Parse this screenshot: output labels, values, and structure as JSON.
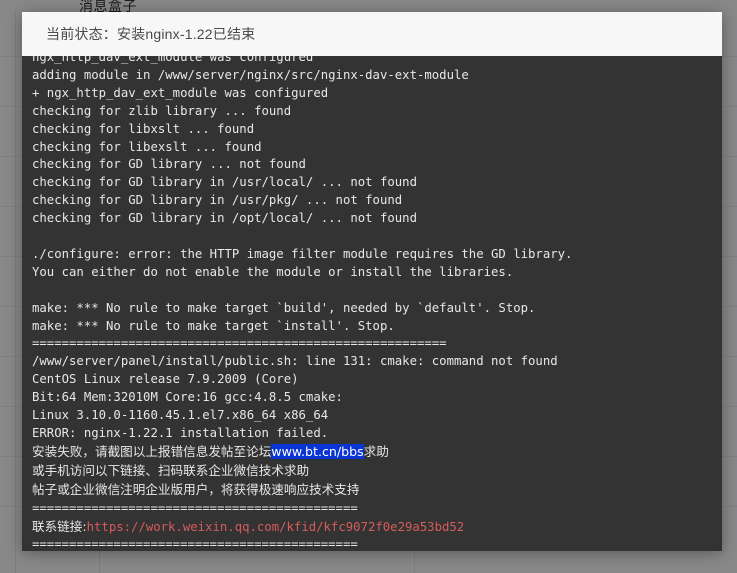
{
  "background": {
    "page_title": "消息盒子"
  },
  "modal": {
    "status_label": "当前状态：安装nginx-1.22已结束"
  },
  "terminal": {
    "colors": {
      "background": "#333333",
      "text": "#e7e7e7",
      "link_red": "#d65b5b",
      "selection_background": "#0a35d5",
      "selection_text": "#ffffff"
    },
    "lines": [
      {
        "id": "line-clipped",
        "text": "ngx_http_dav_ext_module was configured",
        "clipped": true
      },
      {
        "id": "line-adding-module",
        "text": "adding module in /www/server/nginx/src/nginx-dav-ext-module"
      },
      {
        "id": "line-dav-configured",
        "text": "+ ngx_http_dav_ext_module was configured"
      },
      {
        "id": "line-zlib",
        "text": "checking for zlib library ... found"
      },
      {
        "id": "line-libxslt",
        "text": "checking for libxslt ... found"
      },
      {
        "id": "line-libexslt",
        "text": "checking for libexslt ... found"
      },
      {
        "id": "line-gd",
        "text": "checking for GD library ... not found"
      },
      {
        "id": "line-gd-usr-local",
        "text": "checking for GD library in /usr/local/ ... not found"
      },
      {
        "id": "line-gd-usr-pkg",
        "text": "checking for GD library in /usr/pkg/ ... not found"
      },
      {
        "id": "line-gd-opt-local",
        "text": "checking for GD library in /opt/local/ ... not found"
      },
      {
        "id": "line-blank-1",
        "text": ""
      },
      {
        "id": "line-configure-error",
        "text": "./configure: error: the HTTP image filter module requires the GD library."
      },
      {
        "id": "line-configure-hint",
        "text": "You can either do not enable the module or install the libraries."
      },
      {
        "id": "line-blank-2",
        "text": ""
      },
      {
        "id": "line-make-build",
        "text": "make: *** No rule to make target `build', needed by `default'. Stop."
      },
      {
        "id": "line-make-install",
        "text": "make: *** No rule to make target `install'. Stop."
      },
      {
        "id": "line-sep-1",
        "text": "========================================================"
      },
      {
        "id": "line-cmake-missing",
        "text": "/www/server/panel/install/public.sh: line 131: cmake: command not found"
      },
      {
        "id": "line-centos",
        "text": "CentOS Linux release 7.9.2009 (Core)"
      },
      {
        "id": "line-sysinfo",
        "text": "Bit:64 Mem:32010M Core:16 gcc:4.8.5 cmake:"
      },
      {
        "id": "line-kernel",
        "text": "Linux 3.10.0-1160.45.1.el7.x86_64 x86_64"
      },
      {
        "id": "line-error-failed",
        "text": "ERROR: nginx-1.22.1 installation failed."
      }
    ],
    "rich_lines": [
      {
        "id": "line-forum-help",
        "segments": [
          {
            "text": "安装失败，请截图以上报错信息发帖至论坛",
            "style": "cjk"
          },
          {
            "text": "www.bt.cn/bbs",
            "style": "selection"
          },
          {
            "text": "求助",
            "style": "cjk"
          }
        ]
      },
      {
        "id": "line-wechat-help",
        "segments": [
          {
            "text": "或手机访问以下链接、扫码联系企业微信技术求助",
            "style": "cjk"
          }
        ]
      },
      {
        "id": "line-enterprise-note",
        "segments": [
          {
            "text": "帖子或企业微信注明企业版用户，将获得极速响应技术支持",
            "style": "cjk"
          }
        ]
      },
      {
        "id": "line-sep-2",
        "segments": [
          {
            "text": "============================================",
            "style": "plain"
          }
        ]
      },
      {
        "id": "line-contact-link",
        "segments": [
          {
            "text": "联系链接:",
            "style": "cjk"
          },
          {
            "text": "https://work.weixin.qq.com/kfid/kfc9072f0e29a53bd52",
            "style": "red"
          }
        ]
      },
      {
        "id": "line-sep-3",
        "segments": [
          {
            "text": "============================================",
            "style": "plain"
          }
        ]
      }
    ]
  }
}
